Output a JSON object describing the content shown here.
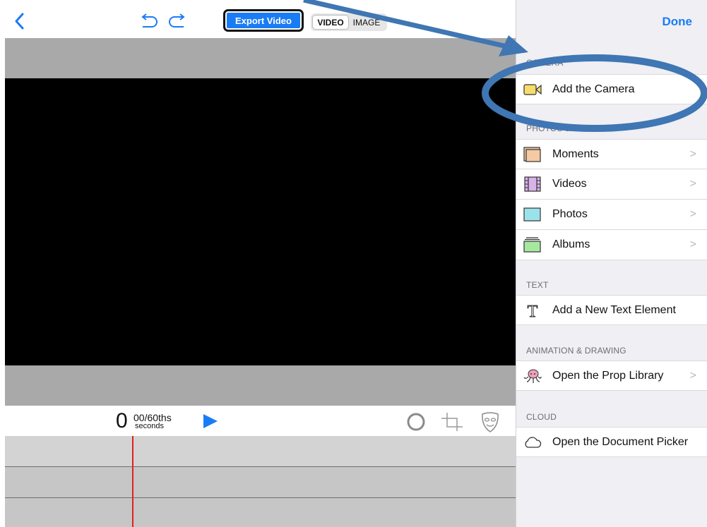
{
  "toolbar": {
    "back_icon": "chevron-left-icon",
    "undo_icon": "undo-icon",
    "redo_icon": "redo-icon",
    "export_label": "Export Video",
    "mode_video": "VIDEO",
    "mode_image": "IMAGE",
    "selected_mode": "VIDEO"
  },
  "playback": {
    "seconds": "0",
    "fraction": "00/60ths",
    "unit": "seconds"
  },
  "tools": {
    "record_icon": "circle-icon",
    "crop_icon": "crop-icon",
    "mask_icon": "mask-icon"
  },
  "panel": {
    "done_label": "Done",
    "sections": {
      "camera": {
        "header": "CAMERA",
        "items": [
          {
            "label": "Add the Camera",
            "icon": "camera-icon"
          }
        ]
      },
      "photos_videos": {
        "header": "PHOTOS & VIDEOS",
        "items": [
          {
            "label": "Moments",
            "icon": "moments-icon"
          },
          {
            "label": "Videos",
            "icon": "film-icon"
          },
          {
            "label": "Photos",
            "icon": "photo-icon"
          },
          {
            "label": "Albums",
            "icon": "album-icon"
          }
        ]
      },
      "text": {
        "header": "TEXT",
        "items": [
          {
            "label": "Add a New Text Element",
            "icon": "text-icon"
          }
        ]
      },
      "animation": {
        "header": "ANIMATION & DRAWING",
        "items": [
          {
            "label": "Open the Prop Library",
            "icon": "octopus-icon"
          }
        ]
      },
      "cloud": {
        "header": "CLOUD",
        "items": [
          {
            "label": "Open the Document Picker",
            "icon": "cloud-icon"
          }
        ]
      }
    }
  },
  "colors": {
    "accent": "#1a7cf5",
    "playhead": "#e02020",
    "annotation": "#3f76b3"
  }
}
